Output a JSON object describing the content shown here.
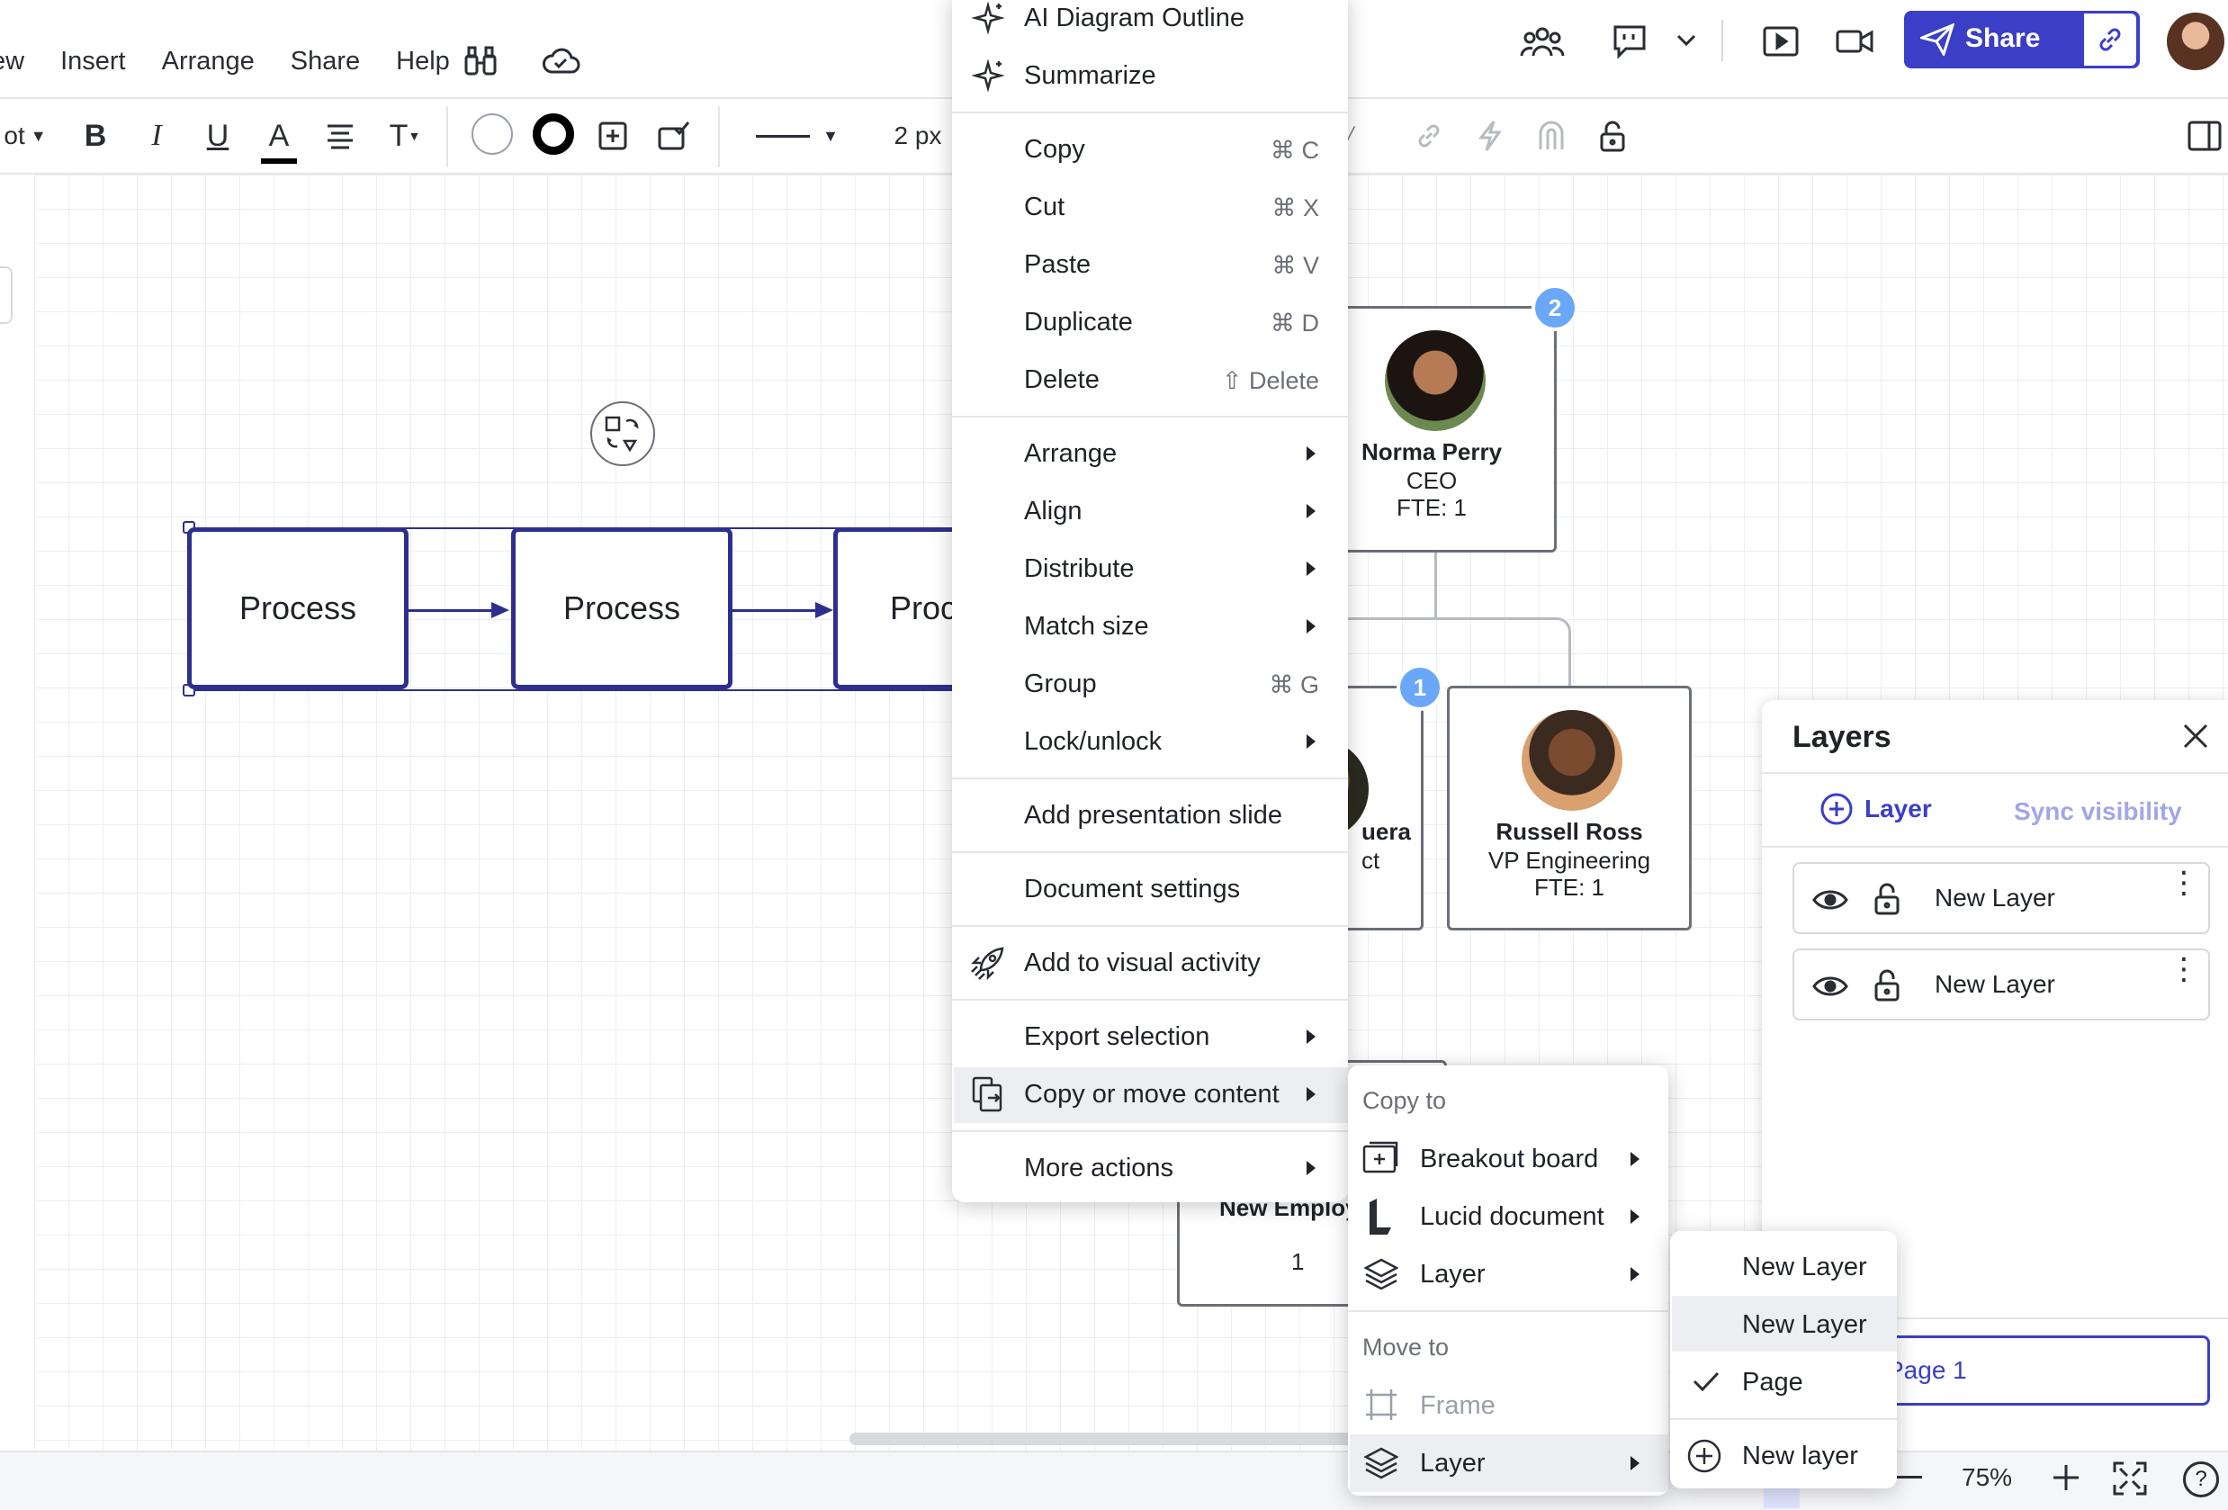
{
  "menubar": {
    "items": [
      "ew",
      "Insert",
      "Arrange",
      "Share",
      "Help"
    ]
  },
  "header": {
    "share_label": "Share"
  },
  "toolbar": {
    "font_fragment": "ot",
    "bold": "B",
    "italic": "I",
    "underline": "U",
    "text_color": "A",
    "text_format": "T",
    "line_width": "2 px"
  },
  "canvas": {
    "process_boxes": [
      "Process",
      "Process",
      "Proc"
    ],
    "org_cards": [
      {
        "name": "Norma Perry",
        "title": "CEO",
        "fte": "FTE: 1",
        "badge": "2"
      },
      {
        "name": "uera",
        "title": "ct",
        "badge": "1"
      },
      {
        "name": "Russell Ross",
        "title": "VP Engineering",
        "fte": "FTE: 1"
      },
      {
        "name": "New Employ",
        "value": "1"
      }
    ]
  },
  "context_menu": {
    "ai_outline": "AI Diagram Outline",
    "summarize": "Summarize",
    "copy": {
      "label": "Copy",
      "shortcut": "⌘ C"
    },
    "cut": {
      "label": "Cut",
      "shortcut": "⌘ X"
    },
    "paste": {
      "label": "Paste",
      "shortcut": "⌘ V"
    },
    "duplicate": {
      "label": "Duplicate",
      "shortcut": "⌘ D"
    },
    "delete": {
      "label": "Delete",
      "shortcut": "⇧ Delete"
    },
    "arrange": "Arrange",
    "align": "Align",
    "distribute": "Distribute",
    "match_size": "Match size",
    "group": {
      "label": "Group",
      "shortcut": "⌘ G"
    },
    "lock_unlock": "Lock/unlock",
    "add_presentation_slide": "Add presentation slide",
    "document_settings": "Document settings",
    "add_visual_activity": "Add to visual activity",
    "export_selection": "Export selection",
    "copy_or_move": "Copy or move content",
    "more_actions": "More actions"
  },
  "submenu": {
    "copy_to": "Copy to",
    "breakout_board": "Breakout board",
    "lucid_document": "Lucid document",
    "layer": "Layer",
    "move_to": "Move to",
    "frame": "Frame",
    "move_layer": "Layer"
  },
  "submenu2": {
    "items": [
      "New Layer",
      "New Layer",
      "Page"
    ],
    "new_layer": "New layer"
  },
  "layers_panel": {
    "title": "Layers",
    "add_layer": "Layer",
    "sync_visibility": "Sync visibility",
    "layers": [
      "New Layer",
      "New Layer"
    ],
    "page": "Page 1"
  },
  "bottombar": {
    "zoom": "75%"
  },
  "colors": {
    "accent": "#3b3fc7",
    "selection": "#2d2f8f",
    "badge": "#6aa7f8"
  }
}
